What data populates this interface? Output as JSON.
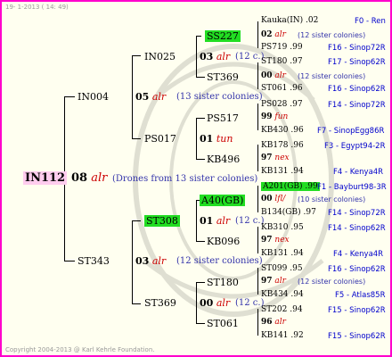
{
  "header": {
    "date": "19-  1-2013 ( 14: 49)"
  },
  "footer": {
    "copyright": "Copyright 2004-2013 @ Karl Kehrle Foundation."
  },
  "root": {
    "id": "IN112",
    "year": "08",
    "code": "alr",
    "note": "(Drones from 13 sister colonies)"
  },
  "gen1": [
    {
      "id": "IN004",
      "year": "05",
      "code": "alr",
      "note": "(13 sister colonies)"
    },
    {
      "id": "ST343",
      "year": "03",
      "code": "alr",
      "note": "(12 sister colonies)"
    }
  ],
  "gen2": [
    {
      "id": "IN025",
      "year": "03",
      "code": "alr",
      "note": "(12 c.)"
    },
    {
      "id": "PS017",
      "year": "01",
      "code": "tun",
      "note": ""
    },
    {
      "id": "ST308",
      "year": "01",
      "code": "alr",
      "note": "(12 c.)"
    },
    {
      "id": "ST369",
      "year": "00",
      "code": "alr",
      "note": "(12 c.)"
    }
  ],
  "gen3": [
    {
      "id": "SS227"
    },
    {
      "id": "ST369"
    },
    {
      "id": "PS517"
    },
    {
      "id": "KB496"
    },
    {
      "id": "A40(GB)"
    },
    {
      "id": "KB096"
    },
    {
      "id": "ST180"
    },
    {
      "id": "ST061"
    }
  ],
  "gen4": [
    {
      "id": "Kauka(IN)",
      "year": ".02",
      "origin": "F0 - Ren"
    },
    {
      "id": "02",
      "code": "alr",
      "note": "(12 sister colonies)"
    },
    {
      "id": "PS719",
      "year": ".99",
      "origin": "F16 - Sinop72R"
    },
    {
      "id": "ST180",
      "year": ".97",
      "origin": "F17 - Sinop62R"
    },
    {
      "id": "00",
      "code": "alr",
      "note": "(12 sister colonies)"
    },
    {
      "id": "ST061",
      "year": ".96",
      "origin": "F16 - Sinop62R"
    },
    {
      "id": "PS028",
      "year": ".97",
      "origin": "F14 - Sinop72R"
    },
    {
      "id": "99",
      "code": "fun",
      "note": ""
    },
    {
      "id": "KB430",
      "year": ".96",
      "origin": "F7 - SinopEgg86R"
    },
    {
      "id": "KB178",
      "year": ".96",
      "origin": "F3 - Egypt94-2R"
    },
    {
      "id": "97",
      "code": "nex",
      "note": ""
    },
    {
      "id": "KB131",
      "year": ".94",
      "origin": "F4 - Kenya4R"
    },
    {
      "id": "A201(GB)",
      "year": ".99",
      "origin": "F1 - Bayburt98-3R"
    },
    {
      "id": "00",
      "code": "lfl/",
      "note": "(10 sister colonies)"
    },
    {
      "id": "B134(GB)",
      "year": ".97",
      "origin": "F14 - Sinop72R"
    },
    {
      "id": "KB310",
      "year": ".95",
      "origin": "F14 - Sinop62R"
    },
    {
      "id": "97",
      "code": "nex",
      "note": ""
    },
    {
      "id": "KB131",
      "year": ".94",
      "origin": "F4 - Kenya4R"
    },
    {
      "id": "ST099",
      "year": ".95",
      "origin": "F16 - Sinop62R"
    },
    {
      "id": "97",
      "code": "alr",
      "note": "(12 sister colonies)"
    },
    {
      "id": "KB434",
      "year": ".94",
      "origin": "F5 - Atlas85R"
    },
    {
      "id": "ST202",
      "year": ".94",
      "origin": "F15 - Sinop62R"
    },
    {
      "id": "96",
      "code": "alr",
      "note": ""
    },
    {
      "id": "KB141",
      "year": ".92",
      "origin": "F15 - Sinop62R"
    }
  ],
  "colors": {
    "border": "#ff00cc",
    "background": "#fffff0",
    "highlight_green": "#22dd22",
    "highlight_pink": "#ffccee",
    "red": "#cc0000",
    "blue": "#0000cc"
  }
}
